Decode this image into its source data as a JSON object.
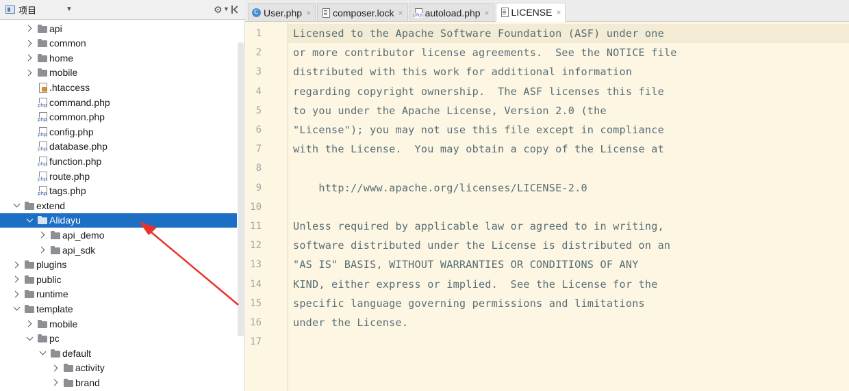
{
  "project_panel": {
    "title": "项目",
    "tree": [
      {
        "label": "api",
        "type": "folder",
        "chevron": "right",
        "depth": 2
      },
      {
        "label": "common",
        "type": "folder",
        "chevron": "right",
        "depth": 2
      },
      {
        "label": "home",
        "type": "folder",
        "chevron": "right",
        "depth": 2
      },
      {
        "label": "mobile",
        "type": "folder",
        "chevron": "right",
        "depth": 2
      },
      {
        "label": ".htaccess",
        "type": "htaccess",
        "chevron": "none",
        "depth": 2
      },
      {
        "label": "command.php",
        "type": "php",
        "chevron": "none",
        "depth": 2
      },
      {
        "label": "common.php",
        "type": "php",
        "chevron": "none",
        "depth": 2
      },
      {
        "label": "config.php",
        "type": "php",
        "chevron": "none",
        "depth": 2
      },
      {
        "label": "database.php",
        "type": "php",
        "chevron": "none",
        "depth": 2
      },
      {
        "label": "function.php",
        "type": "php",
        "chevron": "none",
        "depth": 2
      },
      {
        "label": "route.php",
        "type": "php",
        "chevron": "none",
        "depth": 2
      },
      {
        "label": "tags.php",
        "type": "php",
        "chevron": "none",
        "depth": 2
      },
      {
        "label": "extend",
        "type": "folder",
        "chevron": "down",
        "depth": 1
      },
      {
        "label": "Alidayu",
        "type": "folder",
        "chevron": "down",
        "depth": 2,
        "selected": true
      },
      {
        "label": "api_demo",
        "type": "folder",
        "chevron": "right",
        "depth": 3
      },
      {
        "label": "api_sdk",
        "type": "folder",
        "chevron": "right",
        "depth": 3
      },
      {
        "label": "plugins",
        "type": "folder",
        "chevron": "right",
        "depth": 1
      },
      {
        "label": "public",
        "type": "folder",
        "chevron": "right",
        "depth": 1
      },
      {
        "label": "runtime",
        "type": "folder",
        "chevron": "right",
        "depth": 1
      },
      {
        "label": "template",
        "type": "folder",
        "chevron": "down",
        "depth": 1
      },
      {
        "label": "mobile",
        "type": "folder",
        "chevron": "right",
        "depth": 2
      },
      {
        "label": "pc",
        "type": "folder",
        "chevron": "down",
        "depth": 2
      },
      {
        "label": "default",
        "type": "folder",
        "chevron": "down",
        "depth": 3
      },
      {
        "label": "activity",
        "type": "folder",
        "chevron": "right",
        "depth": 4
      },
      {
        "label": "brand",
        "type": "folder",
        "chevron": "right",
        "depth": 4
      }
    ]
  },
  "editor": {
    "tabs": [
      {
        "label": "User.php",
        "icon": "class-icon",
        "active": false
      },
      {
        "label": "composer.lock",
        "icon": "lock-file-icon",
        "active": false
      },
      {
        "label": "autoload.php",
        "icon": "php-file-icon",
        "active": false
      },
      {
        "label": "LICENSE",
        "icon": "text-file-icon",
        "active": true
      }
    ],
    "close_glyph": "×",
    "lines": [
      "Licensed to the Apache Software Foundation (ASF) under one",
      "or more contributor license agreements.  See the NOTICE file",
      "distributed with this work for additional information",
      "regarding copyright ownership.  The ASF licenses this file",
      "to you under the Apache License, Version 2.0 (the",
      "\"License\"); you may not use this file except in compliance",
      "with the License.  You may obtain a copy of the License at",
      "",
      "    http://www.apache.org/licenses/LICENSE-2.0",
      "",
      "Unless required by applicable law or agreed to in writing,",
      "software distributed under the License is distributed on an",
      "\"AS IS\" BASIS, WITHOUT WARRANTIES OR CONDITIONS OF ANY",
      "KIND, either express or implied.  See the License for the",
      "specific language governing permissions and limitations",
      "under the License.",
      ""
    ]
  },
  "colors": {
    "selection": "#1c6fc4",
    "editor_background": "#fdf6e3",
    "annotation_arrow": "#e8332b"
  }
}
